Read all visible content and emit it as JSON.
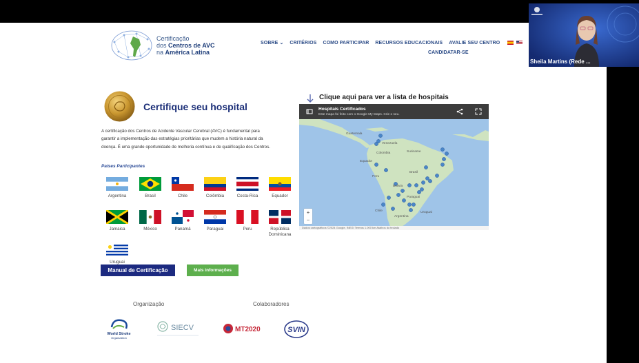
{
  "logo": {
    "line1": "Certificação",
    "line2_pre": "dos ",
    "line2_bold": "Centros de AVC",
    "line3_pre": "na ",
    "line3_bold": "América Latina"
  },
  "nav": {
    "items": [
      "SOBRE",
      "CRITÉRIOS",
      "COMO PARTICIPAR",
      "RECURSOS EDUCACIONAIS",
      "AVALIE SEU CENTRO"
    ],
    "cta": "CANDIDATAR-SE"
  },
  "hero": {
    "title": "Certifique seu hospital",
    "description": "A certificação dos Centros de Acidente Vascular Cerebral (AVC) é fundamental para garantir a implementação das estratégias prioritárias que mudem a história natural da doença. É uma grande oportunidade de melhoria contínua e de qualificação dos Centros.",
    "countries_title": "Países Participantes"
  },
  "countries": [
    "Argentina",
    "Brasil",
    "Chile",
    "Colômbia",
    "Costa-Rica",
    "Equador",
    "Jamaica",
    "México",
    "Panamá",
    "Paraguai",
    "Peru",
    "República Dominicana",
    "Uruguai"
  ],
  "buttons": {
    "manual": "Manual de Certificação",
    "info": "Mais informações"
  },
  "partners": {
    "org_label": "Organização",
    "collab_label": "Colaboradores"
  },
  "map": {
    "cta": "Clique aqui para ver a lista de hospitais",
    "title": "Hospitais Certificados",
    "subtitle": "Este mapa foi feito com o Google My Maps. Crie o seu.",
    "footer": "Dados cartográficos ©2024 Google, INEGI   Termos   1.000 km         Atalhos do teclado",
    "labels": [
      "Guatemala",
      "Venezuela",
      "Colombia",
      "Equador",
      "Peru",
      "Bolivia",
      "Brasil",
      "Suriname",
      "Paraguai",
      "Chile",
      "Argentina",
      "Uruguai"
    ]
  },
  "video": {
    "name": "Sheila Martins (Rede ..."
  }
}
